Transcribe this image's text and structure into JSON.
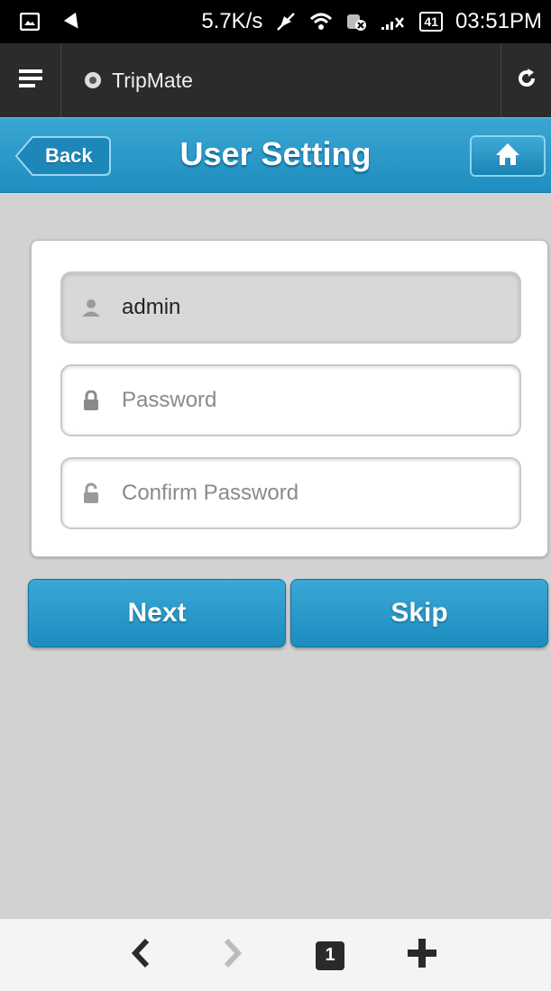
{
  "status_bar": {
    "speed": "5.7K/s",
    "battery": "41",
    "time": "03:51PM"
  },
  "browser": {
    "site_name": "TripMate"
  },
  "header": {
    "back_label": "Back",
    "title": "User Setting"
  },
  "form": {
    "username_value": "admin",
    "password_placeholder": "Password",
    "confirm_placeholder": "Confirm Password"
  },
  "buttons": {
    "next_label": "Next",
    "skip_label": "Skip"
  },
  "bottom_nav": {
    "tab_count": "1"
  },
  "colors": {
    "accent": "#2897c8",
    "background": "#d2d2d2",
    "statusbar": "#000000",
    "browserbar": "#2b2b2b"
  },
  "icons": [
    "image-icon",
    "signal-off-icon",
    "notification-off-icon",
    "wifi-icon",
    "sim-icon",
    "network-icon",
    "menu-icon",
    "reload-icon",
    "home-icon",
    "user-icon",
    "lock-icon",
    "lock-open-icon",
    "chevron-left-icon",
    "chevron-right-icon",
    "plus-icon"
  ]
}
